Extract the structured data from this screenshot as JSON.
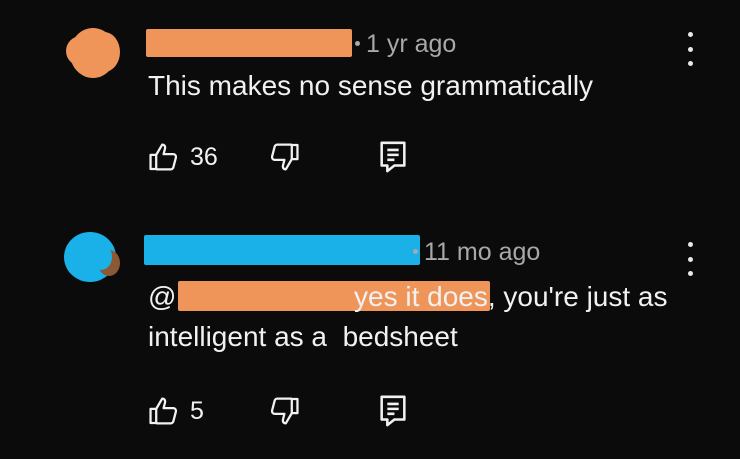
{
  "comments": [
    {
      "timestamp": "1 yr ago",
      "text": "This makes no sense grammatically",
      "likes": "36",
      "avatar_color": "#f0955a",
      "redaction_color": "#f0955a"
    },
    {
      "timestamp": "11 mo ago",
      "mention_prefix": "@",
      "text_line1": "yes it does, you're just as",
      "text_line2": "intelligent as a  bedsheet",
      "likes": "5",
      "avatar_color": "#1ab0e8",
      "redaction_color": "#1ab0e8",
      "mention_redaction_color": "#f0955a"
    }
  ],
  "icons": {
    "like": "thumb-up-icon",
    "dislike": "thumb-down-icon",
    "reply": "reply-icon",
    "menu": "more-vert-icon"
  }
}
